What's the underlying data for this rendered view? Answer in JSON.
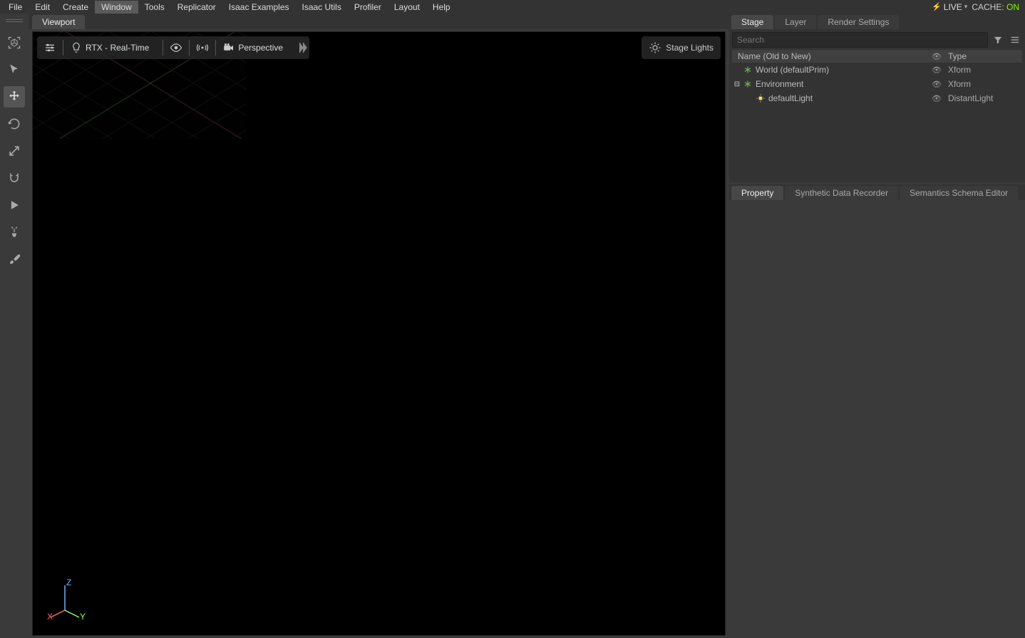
{
  "menubar": {
    "items": [
      "File",
      "Edit",
      "Create",
      "Window",
      "Tools",
      "Replicator",
      "Isaac Examples",
      "Isaac Utils",
      "Profiler",
      "Layout",
      "Help"
    ],
    "highlighted": "Window",
    "live": "LIVE",
    "cache_label": "CACHE:",
    "cache_value": "ON"
  },
  "center": {
    "tab": "Viewport",
    "toolbar": {
      "renderer": "RTX - Real-Time",
      "camera": "Perspective",
      "lights": "Stage Lights"
    },
    "axis": {
      "x": "X",
      "y": "Y",
      "z": "Z"
    }
  },
  "right": {
    "tabs": {
      "stage": "Stage",
      "layer": "Layer",
      "render": "Render Settings"
    },
    "search_placeholder": "Search",
    "columns": {
      "name": "Name (Old to New)",
      "type": "Type"
    },
    "rows": [
      {
        "indent": 0,
        "expander": "",
        "icon": "xform",
        "label": "World (defaultPrim)",
        "type": "Xform"
      },
      {
        "indent": 0,
        "expander": "⊟",
        "icon": "xform",
        "label": "Environment",
        "type": "Xform"
      },
      {
        "indent": 1,
        "expander": "",
        "icon": "light",
        "label": "defaultLight",
        "type": "DistantLight"
      }
    ],
    "prop_tabs": {
      "property": "Property",
      "sdr": "Synthetic Data Recorder",
      "sse": "Semantics Schema Editor"
    }
  }
}
